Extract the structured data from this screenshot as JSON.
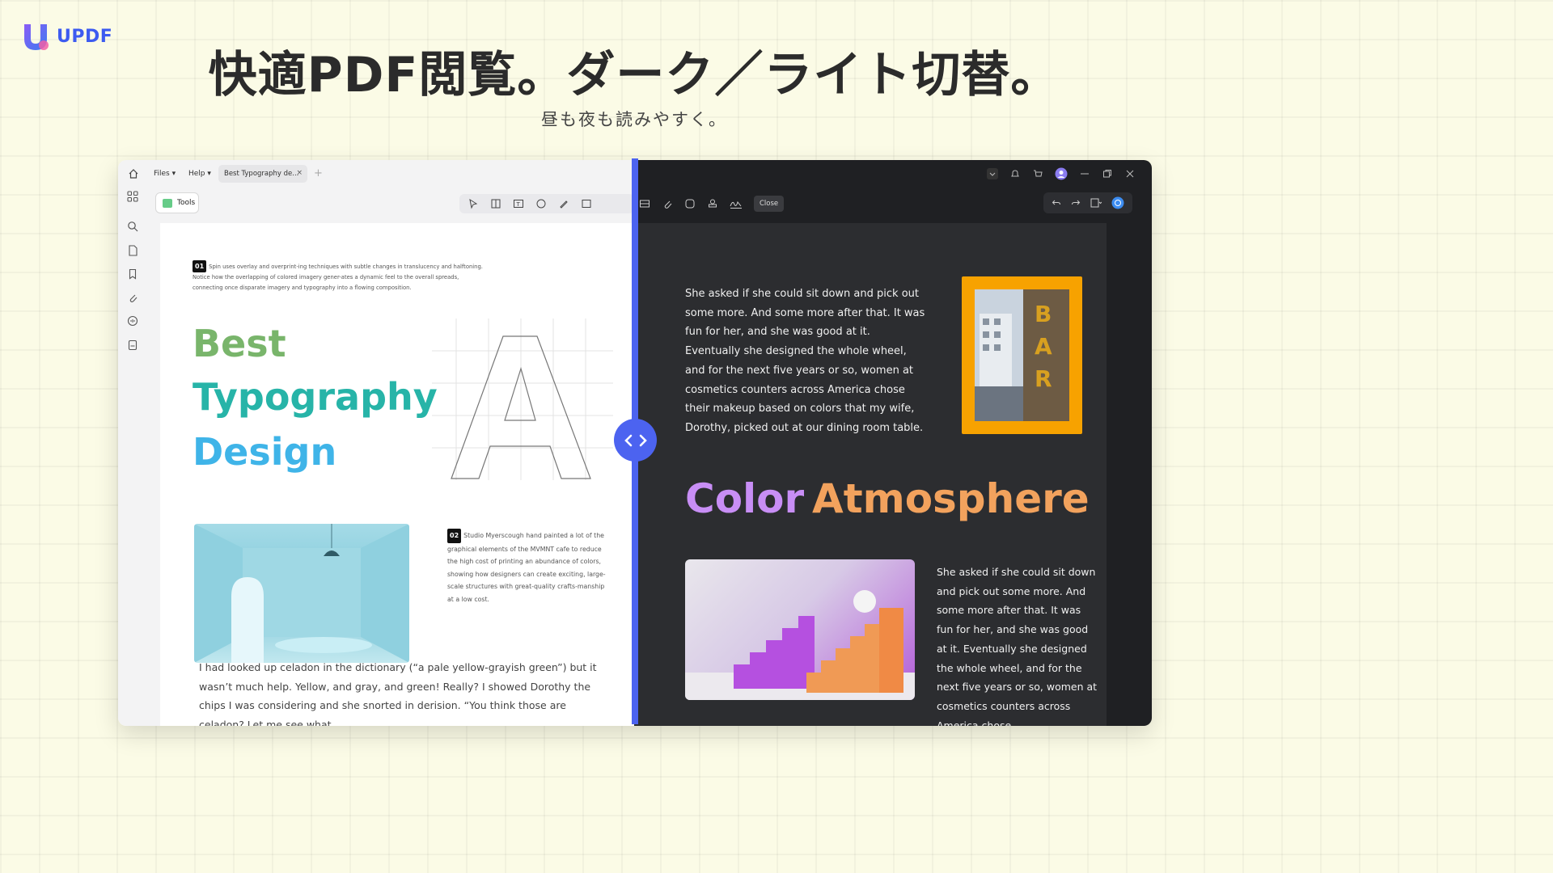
{
  "brand": {
    "logo_text": "UPDF",
    "accent": "#4c63f0"
  },
  "hero": {
    "headline": "快適PDF閲覧。ダーク／ライト切替。",
    "subhead": "昼も夜も読みやすく。"
  },
  "app": {
    "menu": {
      "files": "Files",
      "help": "Help"
    },
    "tab": {
      "title": "Best Typography de...",
      "close": "×",
      "add": "+"
    },
    "toolbar": {
      "tools_label": "Tools",
      "close_label": "Close"
    }
  },
  "light_page": {
    "step01": "01",
    "para01": "Spin uses overlay and overprint-ing techniques with subtle changes in translucency and halftoning. Notice how the overlapping of colored imagery gener-ates a dynamic feel to the overall spreads, connecting once disparate imagery and typography into a flowing composition.",
    "title_line1": "Best",
    "title_line2": "Typography",
    "title_line3": "Design",
    "step02": "02",
    "para02": "Studio Myerscough hand painted a lot of the graphical elements of the MVMNT cafe to reduce the high cost of printing an abundance of colors, showing how designers can create exciting, large- scale structures with great-quality crafts-manship at a low cost.",
    "para_bottom": "I had looked up celadon in the dictionary (“a pale yellow-grayish green”) but it wasn’t much help. Yellow, and gray, and green! Really? I showed Dorothy the chips I was considering and she snorted in derision. “You think those are celadon? Let me see what"
  },
  "dark_page": {
    "para1": "She asked if she could sit down and pick out some more. And some more after that. It was fun for her, and she was good at it. Eventually she designed the whole wheel, and for the next five years or so, women at cosmetics counters across America chose their makeup based on colors that my wife, Dorothy, picked out at our dining room table.",
    "bar_letters": "BAR",
    "title_word1": "Color",
    "title_word2": "Atmosphere",
    "para2": "She asked if she could sit down and pick out some more. And some more after that. It was fun for her, and she was good at it. Eventually she designed the whole wheel, and for the next five years or so, women at cosmetics counters across America chose"
  },
  "colors": {
    "best": "#79b56b",
    "typography": "#27b4a8",
    "design": "#3fb4e8",
    "color_word": "#c88ef5",
    "atmosphere_word": "#f2a25d",
    "bar_frame": "#f7a200"
  }
}
